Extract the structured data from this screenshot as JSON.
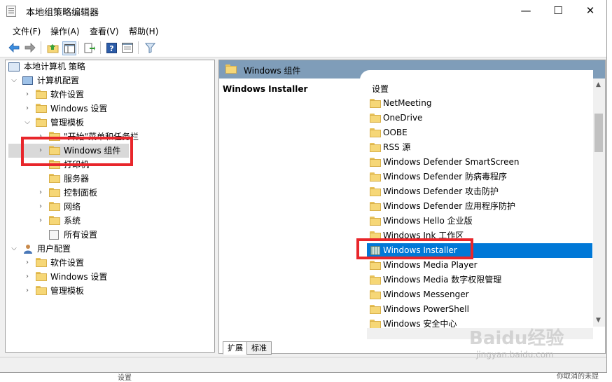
{
  "window": {
    "title": "本地组策略编辑器",
    "controls": {
      "minimize": "—",
      "maximize": "☐",
      "close": "✕"
    }
  },
  "menu": {
    "items": [
      "文件(F)",
      "操作(A)",
      "查看(V)",
      "帮助(H)"
    ]
  },
  "toolbar": {
    "icons": [
      "back-arrow-icon",
      "forward-arrow-icon",
      "folder-up-icon",
      "show-hide-tree-icon",
      "export-list-icon",
      "help-icon",
      "properties-icon",
      "filter-icon"
    ]
  },
  "tree": {
    "root": "本地计算机 策略",
    "computer_config": "计算机配置",
    "computer_children": {
      "software": "软件设置",
      "windows": "Windows 设置",
      "admin": "管理模板"
    },
    "admin_children": {
      "start_menu": "\"开始\"菜单和任务栏",
      "windows_components": "Windows 组件",
      "printers": "打印机",
      "server": "服务器",
      "control_panel": "控制面板",
      "network": "网络",
      "system": "系统",
      "all_settings": "所有设置"
    },
    "user_config": "用户配置",
    "user_children": {
      "software": "软件设置",
      "windows": "Windows 设置",
      "admin": "管理模板"
    }
  },
  "right": {
    "header": "Windows 组件",
    "desc_title": "Windows Installer",
    "settings_header": "设置",
    "items": [
      "NetMeeting",
      "OneDrive",
      "OOBE",
      "RSS 源",
      "Windows Defender SmartScreen",
      "Windows Defender 防病毒程序",
      "Windows Defender 攻击防护",
      "Windows Defender 应用程序防护",
      "Windows Hello 企业版",
      "Windows Ink 工作区",
      "Windows Installer",
      "Windows Media Player",
      "Windows Media 数字权限管理",
      "Windows Messenger",
      "Windows PowerShell",
      "Windows 安全中心"
    ],
    "selected_index": 10
  },
  "tabs": [
    "扩展",
    "标准"
  ],
  "watermark": {
    "brand": "Baidu经验",
    "url": "jingyan.baidu.com"
  },
  "background": {
    "bottom_left": "设置",
    "bottom_right": "你取消的未提"
  },
  "colors": {
    "selection": "#0078d7",
    "header": "#7f9db9",
    "highlight_box": "#e8262b"
  }
}
